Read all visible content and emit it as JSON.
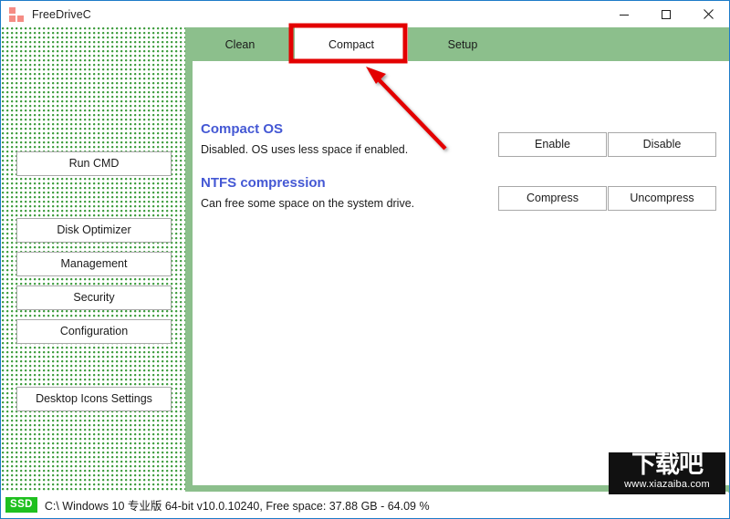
{
  "window": {
    "title": "FreeDriveC",
    "logo_icon": "app-squares-icon",
    "controls": [
      {
        "name": "minimize",
        "icon": "minimize-icon"
      },
      {
        "name": "maximize",
        "icon": "maximize-icon"
      },
      {
        "name": "close",
        "icon": "close-icon"
      }
    ]
  },
  "sidebar": {
    "buttons": [
      {
        "label": "Run CMD"
      },
      {
        "label": "Disk Optimizer"
      },
      {
        "label": "Management"
      },
      {
        "label": "Security"
      },
      {
        "label": "Configuration"
      },
      {
        "label": "Desktop Icons Settings"
      }
    ]
  },
  "tabs": [
    {
      "label": "Clean",
      "selected": false
    },
    {
      "label": "Compact",
      "selected": true
    },
    {
      "label": "Setup",
      "selected": false
    }
  ],
  "content": {
    "sections": [
      {
        "title": "Compact OS",
        "description": "Disabled. OS uses less space if enabled.",
        "buttons": [
          {
            "label": "Enable"
          },
          {
            "label": "Disable"
          }
        ]
      },
      {
        "title": "NTFS compression",
        "description": "Can free some space on the system drive.",
        "buttons": [
          {
            "label": "Compress"
          },
          {
            "label": "Uncompress"
          }
        ]
      }
    ]
  },
  "statusbar": {
    "badge": "SSD",
    "text": "C:\\ Windows 10 专业版 64-bit v10.0.10240, Free space: 37.88 GB - 64.09 %"
  },
  "watermark": {
    "text": "下载吧",
    "url": "www.xiazaiba.com"
  },
  "colors": {
    "accent_green": "#8cbf8c",
    "sidebar_dot_green": "#3d9c3d",
    "heading_blue": "#4458d4",
    "annotation_red": "#e30000",
    "badge_green": "#1fc01f",
    "window_border_blue": "#1e7bc8",
    "logo_pink": "#f58c84"
  }
}
